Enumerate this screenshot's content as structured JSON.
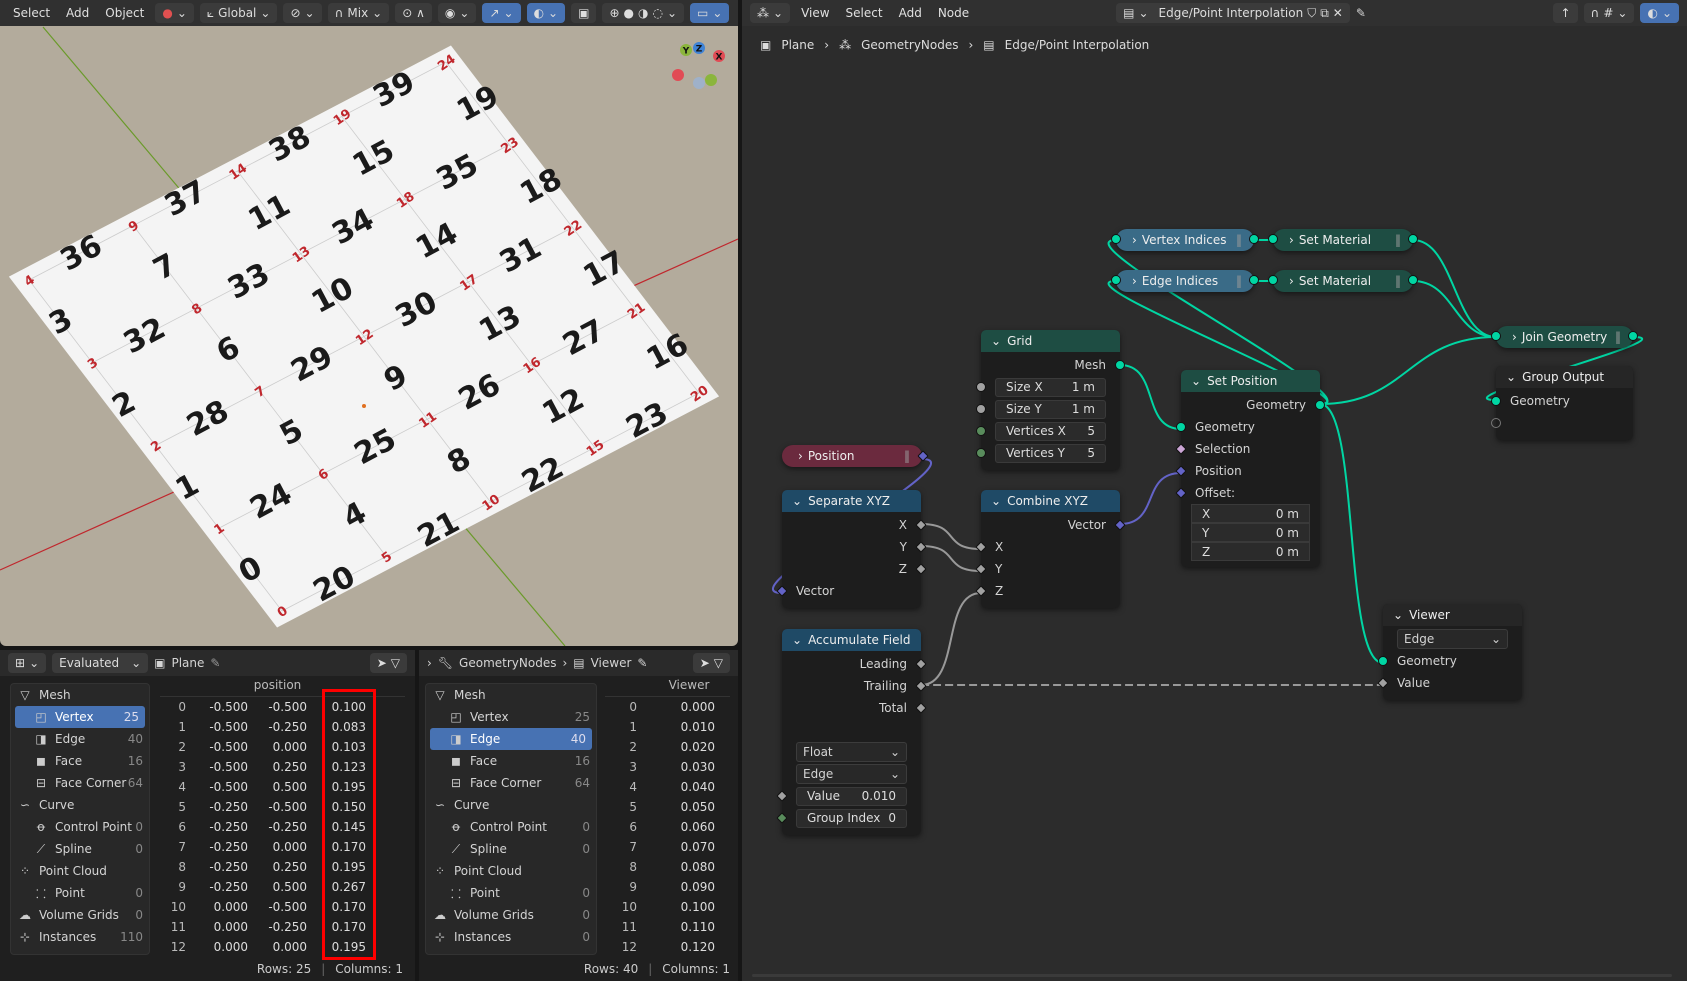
{
  "viewport": {
    "menu": [
      "Select",
      "Add",
      "Object"
    ],
    "orientation": "Global",
    "proportional": "Mix",
    "vertex_labels": [
      "0",
      "1",
      "2",
      "3",
      "4",
      "5",
      "6",
      "7",
      "8",
      "9",
      "10",
      "11",
      "12",
      "13",
      "14",
      "15",
      "16",
      "17",
      "18",
      "19",
      "20",
      "21",
      "22",
      "23",
      "24"
    ],
    "edge_labels": [
      "0",
      "1",
      "2",
      "3",
      "4",
      "5",
      "6",
      "7",
      "8",
      "9",
      "10",
      "11",
      "12",
      "13",
      "14",
      "15",
      "16",
      "17",
      "18",
      "19",
      "20",
      "21",
      "22",
      "23",
      "24",
      "25",
      "26",
      "27",
      "28",
      "29",
      "30",
      "31",
      "32",
      "33",
      "34",
      "35",
      "36",
      "37",
      "38",
      "39"
    ],
    "gizmo": {
      "x": "X",
      "y": "Y",
      "z": "Z"
    },
    "colors": {
      "background": "#b3ab9c",
      "vertex_label": "#c0272d",
      "edge_label": "#1a1a1a",
      "x_axis": "#c0272d",
      "y_axis": "#6a9a2a"
    }
  },
  "node_editor": {
    "menu": [
      "View",
      "Select",
      "Add",
      "Node"
    ],
    "tree_name": "Edge/Point Interpolation",
    "breadcrumb": [
      "Plane",
      "GeometryNodes",
      "Edge/Point Interpolation"
    ],
    "nodes": {
      "vertex_indices": {
        "title": "Vertex Indices"
      },
      "edge_indices": {
        "title": "Edge Indices"
      },
      "set_material_1": {
        "title": "Set Material"
      },
      "set_material_2": {
        "title": "Set Material"
      },
      "join_geometry": {
        "title": "Join Geometry"
      },
      "position": {
        "title": "Position"
      },
      "grid": {
        "title": "Grid",
        "rows": [
          {
            "t": "out",
            "label": "Mesh",
            "s": "geo"
          },
          {
            "t": "field",
            "label": "Size X",
            "value": "1 m",
            "s": "float"
          },
          {
            "t": "field",
            "label": "Size Y",
            "value": "1 m",
            "s": "float"
          },
          {
            "t": "field",
            "label": "Vertices X",
            "value": "5",
            "s": "int"
          },
          {
            "t": "field",
            "label": "Vertices Y",
            "value": "5",
            "s": "int"
          }
        ]
      },
      "set_position": {
        "title": "Set Position",
        "rows": [
          {
            "t": "out",
            "label": "Geometry",
            "s": "geo"
          },
          {
            "t": "in",
            "label": "Geometry",
            "s": "geo"
          },
          {
            "t": "in",
            "label": "Selection",
            "s": "bool"
          },
          {
            "t": "in",
            "label": "Position",
            "s": "vec"
          },
          {
            "t": "in",
            "label": "Offset:",
            "s": "vec"
          },
          {
            "t": "vec",
            "label": "X",
            "value": "0 m"
          },
          {
            "t": "vec",
            "label": "Y",
            "value": "0 m"
          },
          {
            "t": "vec",
            "label": "Z",
            "value": "0 m"
          }
        ]
      },
      "group_output": {
        "title": "Group Output",
        "rows": [
          {
            "t": "in",
            "label": "Geometry",
            "s": "geo"
          },
          {
            "t": "in",
            "label": "",
            "s": "empty"
          }
        ]
      },
      "separate_xyz": {
        "title": "Separate XYZ",
        "rows": [
          {
            "t": "out",
            "label": "X",
            "s": "floatd"
          },
          {
            "t": "out",
            "label": "Y",
            "s": "floatd"
          },
          {
            "t": "out",
            "label": "Z",
            "s": "floatd"
          },
          {
            "t": "in",
            "label": "Vector",
            "s": "vec"
          }
        ]
      },
      "combine_xyz": {
        "title": "Combine XYZ",
        "rows": [
          {
            "t": "out",
            "label": "Vector",
            "s": "vec"
          },
          {
            "t": "in",
            "label": "X",
            "s": "floatd"
          },
          {
            "t": "in",
            "label": "Y",
            "s": "floatd"
          },
          {
            "t": "in",
            "label": "Z",
            "s": "floatd"
          }
        ]
      },
      "accumulate_field": {
        "title": "Accumulate Field",
        "rows": [
          {
            "t": "out",
            "label": "Leading",
            "s": "floatd"
          },
          {
            "t": "out",
            "label": "Trailing",
            "s": "floatd"
          },
          {
            "t": "out",
            "label": "Total",
            "s": "floatd"
          },
          {
            "t": "blank"
          },
          {
            "t": "select",
            "value": "Float"
          },
          {
            "t": "select",
            "value": "Edge"
          },
          {
            "t": "field",
            "label": "Value",
            "value": "0.010",
            "s": "floatd"
          },
          {
            "t": "field",
            "label": "Group Index",
            "value": "0",
            "s": "intd"
          }
        ]
      },
      "viewer": {
        "title": "Viewer",
        "rows": [
          {
            "t": "select",
            "value": "Edge"
          },
          {
            "t": "in",
            "label": "Geometry",
            "s": "geo"
          },
          {
            "t": "in",
            "label": "Value",
            "s": "floatd"
          }
        ]
      }
    },
    "socket_colors": {
      "geo": "#00d6a3",
      "vec": "#6363c7",
      "float": "#a1a1a1",
      "floatd": "#a1a1a1",
      "int": "#598c5c",
      "intd": "#598c5c",
      "bool": "#cca6d6",
      "empty": "transparent"
    },
    "header_colors": {
      "geometry": "#1e4d43",
      "converter": "#1f4a66",
      "input": "#6b2a3e",
      "output": "#262626",
      "attribute": "#3a6b87"
    }
  },
  "spreadsheet_left": {
    "mode": "Evaluated",
    "object": "Plane",
    "column": "position",
    "domains": [
      {
        "label": "Mesh",
        "icon": "mesh-icon",
        "level": 0
      },
      {
        "label": "Vertex",
        "count": "25",
        "icon": "vertex-icon",
        "level": 1,
        "selected": true
      },
      {
        "label": "Edge",
        "count": "40",
        "icon": "edge-icon",
        "level": 1
      },
      {
        "label": "Face",
        "count": "16",
        "icon": "face-icon",
        "level": 1
      },
      {
        "label": "Face Corner",
        "count": "64",
        "icon": "face-corner-icon",
        "level": 1
      },
      {
        "label": "Curve",
        "icon": "curve-icon",
        "level": 0
      },
      {
        "label": "Control Point",
        "count": "0",
        "icon": "control-point-icon",
        "level": 1
      },
      {
        "label": "Spline",
        "count": "0",
        "icon": "spline-icon",
        "level": 1
      },
      {
        "label": "Point Cloud",
        "icon": "point-cloud-icon",
        "level": 0
      },
      {
        "label": "Point",
        "count": "0",
        "icon": "point-icon",
        "level": 1
      },
      {
        "label": "Volume Grids",
        "count": "0",
        "icon": "volume-icon",
        "level": 0
      },
      {
        "label": "Instances",
        "count": "110",
        "icon": "instances-icon",
        "level": 0
      }
    ],
    "rows": [
      [
        "0",
        "-0.500",
        "-0.500",
        "0.100"
      ],
      [
        "1",
        "-0.500",
        "-0.250",
        "0.083"
      ],
      [
        "2",
        "-0.500",
        "0.000",
        "0.103"
      ],
      [
        "3",
        "-0.500",
        "0.250",
        "0.123"
      ],
      [
        "4",
        "-0.500",
        "0.500",
        "0.195"
      ],
      [
        "5",
        "-0.250",
        "-0.500",
        "0.150"
      ],
      [
        "6",
        "-0.250",
        "-0.250",
        "0.145"
      ],
      [
        "7",
        "-0.250",
        "0.000",
        "0.170"
      ],
      [
        "8",
        "-0.250",
        "0.250",
        "0.195"
      ],
      [
        "9",
        "-0.250",
        "0.500",
        "0.267"
      ],
      [
        "10",
        "0.000",
        "-0.500",
        "0.170"
      ],
      [
        "11",
        "0.000",
        "-0.250",
        "0.170"
      ],
      [
        "12",
        "0.000",
        "0.000",
        "0.195"
      ]
    ],
    "footer_rows": "Rows: 25",
    "footer_cols": "Columns: 1",
    "highlight_color": "#ff0000"
  },
  "spreadsheet_right": {
    "modifier": "GeometryNodes",
    "node": "Viewer",
    "column": "Viewer",
    "domains": [
      {
        "label": "Mesh",
        "icon": "mesh-icon",
        "level": 0
      },
      {
        "label": "Vertex",
        "count": "25",
        "icon": "vertex-icon",
        "level": 1
      },
      {
        "label": "Edge",
        "count": "40",
        "icon": "edge-icon",
        "level": 1,
        "selected": true
      },
      {
        "label": "Face",
        "count": "16",
        "icon": "face-icon",
        "level": 1
      },
      {
        "label": "Face Corner",
        "count": "64",
        "icon": "face-corner-icon",
        "level": 1
      },
      {
        "label": "Curve",
        "icon": "curve-icon",
        "level": 0
      },
      {
        "label": "Control Point",
        "count": "0",
        "icon": "control-point-icon",
        "level": 1
      },
      {
        "label": "Spline",
        "count": "0",
        "icon": "spline-icon",
        "level": 1
      },
      {
        "label": "Point Cloud",
        "icon": "point-cloud-icon",
        "level": 0
      },
      {
        "label": "Point",
        "count": "0",
        "icon": "point-icon",
        "level": 1
      },
      {
        "label": "Volume Grids",
        "count": "0",
        "icon": "volume-icon",
        "level": 0
      },
      {
        "label": "Instances",
        "count": "0",
        "icon": "instances-icon",
        "level": 0
      }
    ],
    "rows": [
      [
        "0",
        "0.000"
      ],
      [
        "1",
        "0.010"
      ],
      [
        "2",
        "0.020"
      ],
      [
        "3",
        "0.030"
      ],
      [
        "4",
        "0.040"
      ],
      [
        "5",
        "0.050"
      ],
      [
        "6",
        "0.060"
      ],
      [
        "7",
        "0.070"
      ],
      [
        "8",
        "0.080"
      ],
      [
        "9",
        "0.090"
      ],
      [
        "10",
        "0.100"
      ],
      [
        "11",
        "0.110"
      ],
      [
        "12",
        "0.120"
      ]
    ],
    "footer_rows": "Rows: 40",
    "footer_cols": "Columns: 1"
  }
}
